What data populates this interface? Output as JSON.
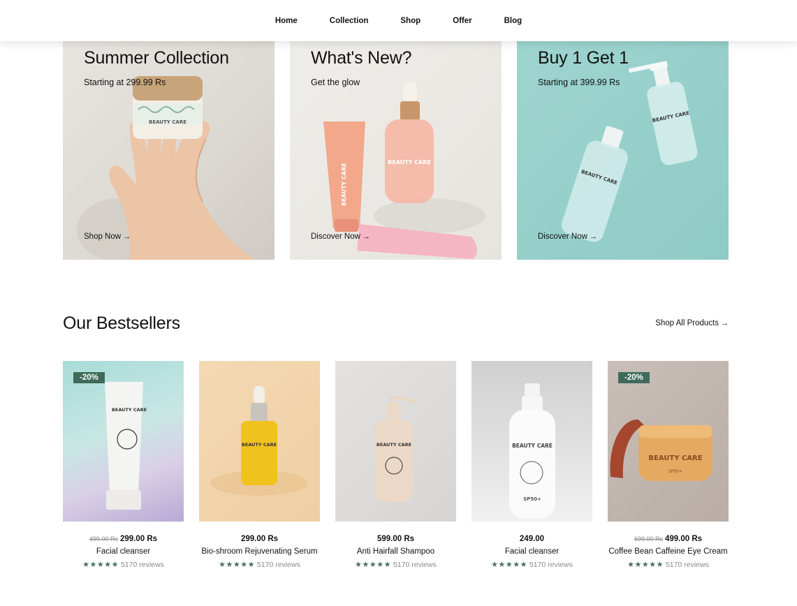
{
  "nav": {
    "items": [
      "Home",
      "Collection",
      "Shop",
      "Offer",
      "Blog"
    ]
  },
  "banners": [
    {
      "title": "Summer Collection",
      "subtitle": "Starting at 299.99 Rs",
      "link": "Shop Now",
      "jar_text": "BEAUTY CARE"
    },
    {
      "title": "What's New?",
      "subtitle": "Get the glow",
      "link": "Discover Now",
      "bottle_text": "BEAUTY CARE",
      "tube_text": "BEAUTY CARE"
    },
    {
      "title": "Buy 1 Get 1",
      "subtitle": "Starting at 399.99 Rs",
      "link": "Discover Now",
      "bottle_text": "BEAUTY CARE"
    }
  ],
  "bestsellers": {
    "title": "Our Bestsellers",
    "shop_all": "Shop All Products",
    "products": [
      {
        "badge": "-20%",
        "old_price": "499.00 Rs",
        "price": "299.00 Rs",
        "name": "Facial cleanser",
        "stars": "★★★★★",
        "reviews": "5170 reviews",
        "label": "BEAUTY CARE"
      },
      {
        "badge": "",
        "old_price": "",
        "price": "299.00 Rs",
        "name": "Bio-shroom Rejuvenating Serum",
        "stars": "★★★★★",
        "reviews": "5170 reviews",
        "label": "BEAUTY CARE"
      },
      {
        "badge": "",
        "old_price": "",
        "price": "599.00 Rs",
        "name": "Anti Hairfall Shampoo",
        "stars": "★★★★★",
        "reviews": "5170 reviews",
        "label": "BEAUTY CARE"
      },
      {
        "badge": "",
        "old_price": "",
        "price": "249.00",
        "name": "Facial cleanser",
        "stars": "★★★★★",
        "reviews": "5170 reviews",
        "label": "BEAUTY CARE",
        "sub_label": "SP50+"
      },
      {
        "badge": "-20%",
        "old_price": "699.00 Rs",
        "price": "499.00 Rs",
        "name": "Coffee Bean Caffeine Eye Cream",
        "stars": "★★★★★",
        "reviews": "5170 reviews",
        "label": "BEAUTY CARE",
        "sub_label": "SP50+"
      }
    ]
  },
  "colors": {
    "badge": "#3f6a5a",
    "stars": "#4a6e5f",
    "banner_teal": "#9ed4cf"
  }
}
